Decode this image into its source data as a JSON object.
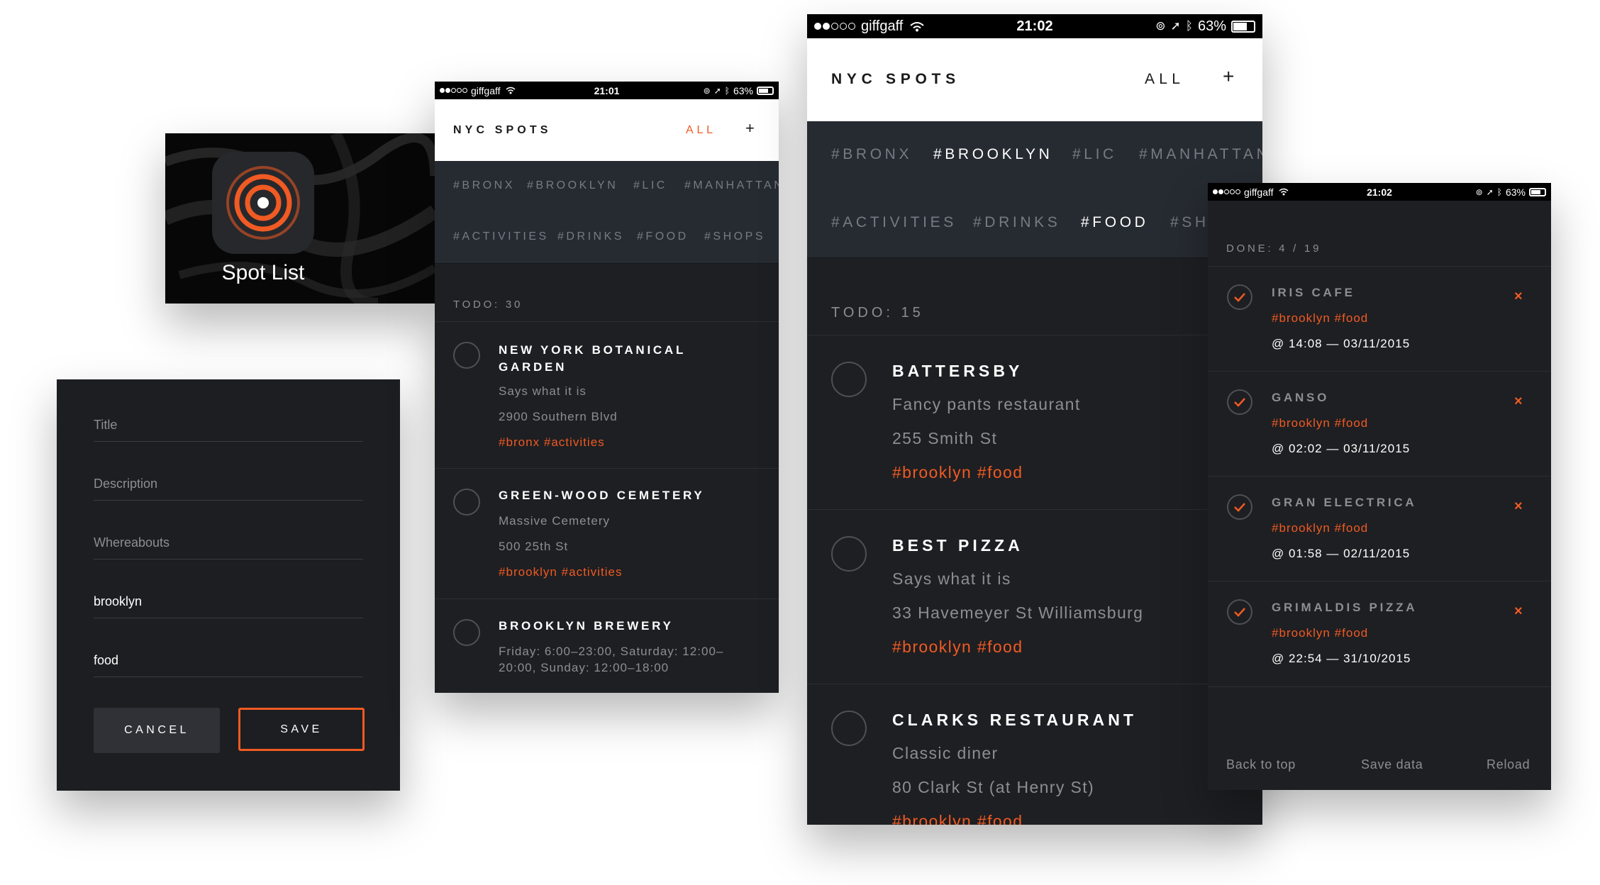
{
  "colors": {
    "accent": "#f05a23",
    "panel": "#1e1f22",
    "tag_bg": "#262a31"
  },
  "app_icon": {
    "label": "Spot List"
  },
  "form": {
    "fields": [
      {
        "placeholder": "Title",
        "value": ""
      },
      {
        "placeholder": "Description",
        "value": ""
      },
      {
        "placeholder": "Whereabouts",
        "value": ""
      },
      {
        "placeholder": "",
        "value": "brooklyn"
      },
      {
        "placeholder": "",
        "value": "food"
      }
    ],
    "cancel_label": "CANCEL",
    "save_label": "SAVE"
  },
  "screen_small": {
    "status": {
      "carrier": "giffgaff",
      "time": "21:01",
      "battery": "63%"
    },
    "header": {
      "title": "NYC SPOTS",
      "filter": "ALL",
      "add": "+"
    },
    "location_tags": [
      "#BRONX",
      "#BROOKLYN",
      "#LIC",
      "#MANHATTAN"
    ],
    "category_tags": [
      "#ACTIVITIES",
      "#DRINKS",
      "#FOOD",
      "#SHOPS"
    ],
    "section": "TODO: 30",
    "items": [
      {
        "title": "NEW YORK BOTANICAL GARDEN",
        "lines": [
          "Says what it is",
          "2900 Southern Blvd"
        ],
        "tags": "#bronx #activities"
      },
      {
        "title": "GREEN-WOOD CEMETERY",
        "lines": [
          "Massive Cemetery",
          "500 25th St"
        ],
        "tags": "#brooklyn #activities"
      },
      {
        "title": "BROOKLYN BREWERY",
        "lines": [
          "Friday: 6:00–23:00, Saturday: 12:00–20:00, Sunday: 12:00–18:00"
        ],
        "tags": ""
      }
    ]
  },
  "screen_large": {
    "status": {
      "carrier": "giffgaff",
      "time": "21:02",
      "battery": "63%"
    },
    "header": {
      "title": "NYC SPOTS",
      "filter": "ALL",
      "add": "+"
    },
    "location_tags": [
      "#BRONX",
      "#BROOKLYN",
      "#LIC",
      "#MANHATTAN"
    ],
    "location_active": "#BROOKLYN",
    "category_tags": [
      "#ACTIVITIES",
      "#DRINKS",
      "#FOOD",
      "#SHOPS"
    ],
    "category_active": "#FOOD",
    "section": "TODO: 15",
    "items": [
      {
        "title": "BATTERSBY",
        "lines": [
          "Fancy pants restaurant",
          "255 Smith St"
        ],
        "tags": "#brooklyn #food"
      },
      {
        "title": "BEST PIZZA",
        "lines": [
          "Says what it is",
          "33 Havemeyer St Williamsburg"
        ],
        "tags": "#brooklyn #food"
      },
      {
        "title": "CLARKS RESTAURANT",
        "lines": [
          "Classic diner",
          "80 Clark St (at Henry St)"
        ],
        "tags": "#brooklyn #food"
      }
    ]
  },
  "screen_done": {
    "status": {
      "carrier": "giffgaff",
      "time": "21:02",
      "battery": "63%"
    },
    "section": "DONE: 4 / 19",
    "items": [
      {
        "title": "IRIS CAFE",
        "tags": "#brooklyn #food",
        "done_at": "@ 14:08 — 03/11/2015",
        "remove": "×"
      },
      {
        "title": "GANSO",
        "tags": "#brooklyn #food",
        "done_at": "@ 02:02 — 03/11/2015",
        "remove": "×"
      },
      {
        "title": "GRAN ELECTRICA",
        "tags": "#brooklyn #food",
        "done_at": "@ 01:58 — 02/11/2015",
        "remove": "×"
      },
      {
        "title": "GRIMALDIS PIZZA",
        "tags": "#brooklyn #food",
        "done_at": "@ 22:54 — 31/10/2015",
        "remove": "×"
      }
    ],
    "footer": {
      "back_to_top": "Back to top",
      "save_data": "Save data",
      "reload": "Reload"
    }
  }
}
